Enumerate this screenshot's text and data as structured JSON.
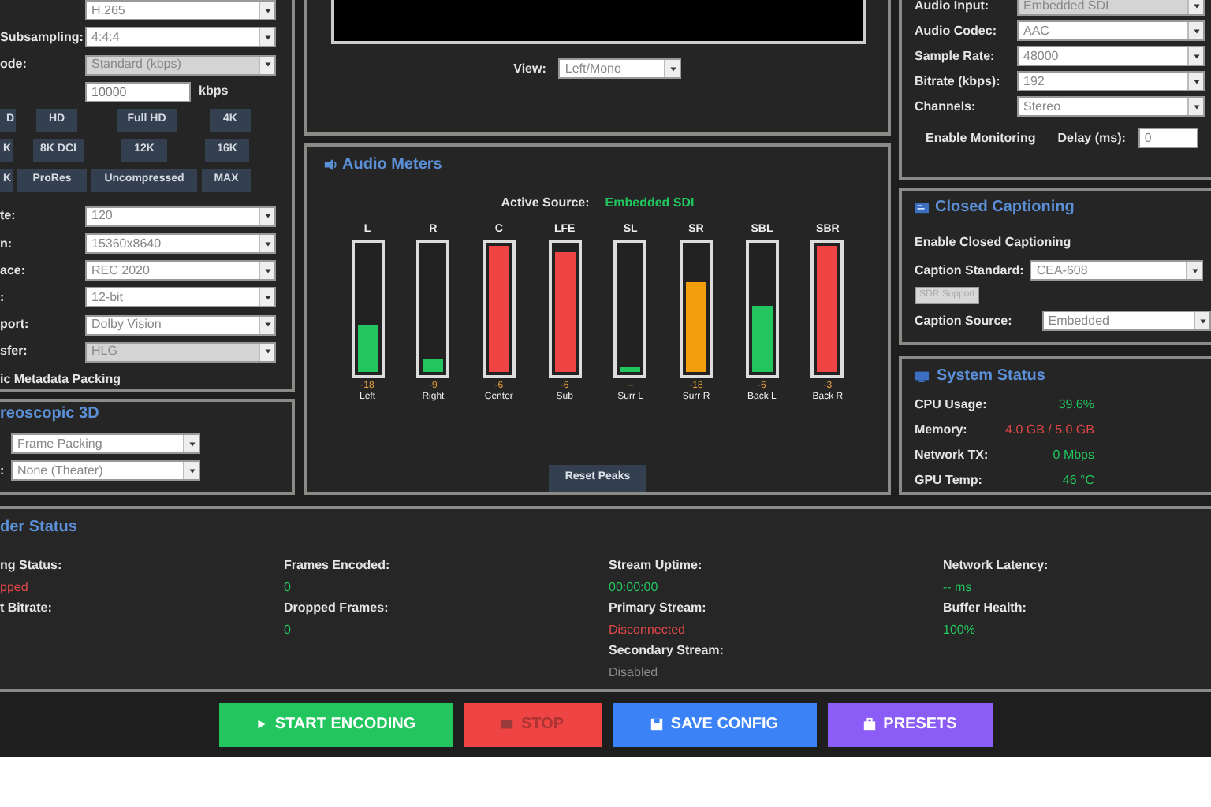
{
  "video_settings": {
    "rows": [
      {
        "kind": "select",
        "value": "H.265",
        "disabled": false
      },
      {
        "kind": "select",
        "label": "Subsampling:",
        "value": "4:4:4",
        "disabled": false
      },
      {
        "kind": "select",
        "label": "ode:",
        "value": "Standard (kbps)",
        "disabled": true
      },
      {
        "kind": "input",
        "value": "10000",
        "unit": "kbps"
      }
    ],
    "presets": [
      [
        "D",
        "HD",
        "Full HD",
        "4K"
      ],
      [
        "K",
        "8K DCI",
        "12K",
        "16K"
      ],
      [
        "K",
        "ProRes",
        "Uncompressed",
        "MAX"
      ]
    ],
    "rows_2": [
      {
        "kind": "select",
        "label": "te:",
        "value": "120",
        "disabled": false
      },
      {
        "kind": "select",
        "label": "n:",
        "value": "15360x8640",
        "disabled": false
      },
      {
        "kind": "select",
        "label": "ace:",
        "value": "REC 2020",
        "disabled": false
      },
      {
        "kind": "select",
        "label": ":",
        "value": "12-bit",
        "disabled": false
      },
      {
        "kind": "select",
        "label": "port:",
        "value": "Dolby Vision",
        "disabled": false
      },
      {
        "kind": "select",
        "label": "sfer:",
        "value": "HLG",
        "disabled": true
      }
    ],
    "option": "ic Metadata Packing"
  },
  "stereoscopic": {
    "title": "reoscopic 3D",
    "rows": [
      {
        "value": "Frame Packing"
      },
      {
        "label": ":",
        "value": "None (Theater)"
      }
    ]
  },
  "preview": {
    "view_label": "View:",
    "view": "Left/Mono"
  },
  "audio_meters": {
    "title": "Audio Meters",
    "source_label": "Active Source:",
    "source": "Embedded SDI",
    "channels": [
      {
        "code": "L",
        "name": "Left",
        "reading": "-18",
        "level": 0.38,
        "color": "#22c55e"
      },
      {
        "code": "R",
        "name": "Right",
        "reading": "-9",
        "level": 0.1,
        "color": "#22c55e"
      },
      {
        "code": "C",
        "name": "Center",
        "reading": "-6",
        "level": 1.0,
        "color": "#ef4444"
      },
      {
        "code": "LFE",
        "name": "Sub",
        "reading": "-6",
        "level": 0.95,
        "color": "#ef4444"
      },
      {
        "code": "SL",
        "name": "Surr L",
        "reading": "--",
        "level": 0.04,
        "color": "#22c55e"
      },
      {
        "code": "SR",
        "name": "Surr R",
        "reading": "-18",
        "level": 0.71,
        "color": "#f59e0b"
      },
      {
        "code": "SBL",
        "name": "Back L",
        "reading": "-6",
        "level": 0.53,
        "color": "#22c55e"
      },
      {
        "code": "SBR",
        "name": "Back R",
        "reading": "-3",
        "level": 1.0,
        "color": "#ef4444"
      }
    ],
    "reset": "Reset Peaks"
  },
  "audio_settings": {
    "rows": [
      {
        "label": "Audio Input:",
        "value": "Embedded SDI",
        "disabled": true
      },
      {
        "label": "Audio Codec:",
        "value": "AAC",
        "disabled": false
      },
      {
        "label": "Sample Rate:",
        "value": "48000",
        "disabled": false
      },
      {
        "label": "Bitrate (kbps):",
        "value": "192",
        "disabled": false
      },
      {
        "label": "Channels:",
        "value": "Stereo",
        "disabled": false
      }
    ],
    "monitoring": "Enable Monitoring",
    "delay_label": "Delay (ms):",
    "delay": "0"
  },
  "closed_captioning": {
    "title": "Closed Captioning",
    "enable": "Enable Closed Captioning",
    "standard_label": "Caption Standard:",
    "standard": "CEA-608",
    "sdr": "SDR Support",
    "source_label": "Caption Source:",
    "source": "Embedded"
  },
  "system_status": {
    "title": "System Status",
    "rows": [
      {
        "label": "CPU Usage:",
        "value": "39.6%",
        "color": "#22c55e"
      },
      {
        "label": "Memory:",
        "value": "4.0 GB / 5.0 GB",
        "color": "#e04848"
      },
      {
        "label": "Network TX:",
        "value": "0 Mbps",
        "color": "#22c55e"
      },
      {
        "label": "GPU Temp:",
        "value": "46 °C",
        "color": "#22c55e"
      }
    ]
  },
  "encoder_status": {
    "title": "der Status",
    "columns": [
      [
        {
          "label": "ng Status:",
          "value": "pped",
          "color": "#e04848"
        },
        {
          "label": "t Bitrate:"
        }
      ],
      [
        {
          "label": "Frames Encoded:",
          "value": "0",
          "color": "#22c55e"
        },
        {
          "label": "Dropped Frames:",
          "value": "0",
          "color": "#22c55e"
        }
      ],
      [
        {
          "label": "Stream Uptime:",
          "value": "00:00:00",
          "color": "#22c55e"
        },
        {
          "label": "Primary Stream:",
          "value": "Disconnected",
          "color": "#e04848"
        },
        {
          "label": "Secondary Stream:",
          "value": "Disabled",
          "color": "#8a8a8a"
        }
      ],
      [
        {
          "label": "Network Latency:",
          "value": "-- ms",
          "color": "#22c55e"
        },
        {
          "label": "Buffer Health:",
          "value": "100%",
          "color": "#22c55e"
        }
      ]
    ]
  },
  "actions": [
    {
      "kind": "start",
      "label": "START ENCODING",
      "disabled": false
    },
    {
      "kind": "stop",
      "label": "STOP",
      "disabled": true
    },
    {
      "kind": "save",
      "label": "SAVE CONFIG",
      "disabled": false
    },
    {
      "kind": "presets",
      "label": "PRESETS",
      "disabled": false
    }
  ]
}
